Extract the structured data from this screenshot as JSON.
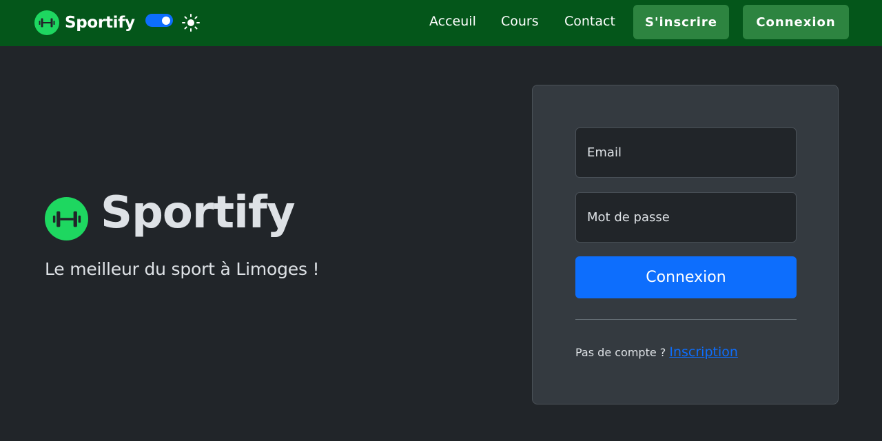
{
  "brand": {
    "name": "Sportify",
    "logo_icon": "dumbbell-icon",
    "logo_color": "#1ed760"
  },
  "theme": {
    "toggle_on": true,
    "toggle_icon": "sun-icon"
  },
  "nav": {
    "links": [
      "Acceuil",
      "Cours",
      "Contact"
    ],
    "signup_button": "S'inscrire",
    "login_button": "Connexion"
  },
  "hero": {
    "title": "Sportify",
    "subtitle": "Le meilleur du sport à Limoges !"
  },
  "login_form": {
    "email_placeholder": "Email",
    "password_placeholder": "Mot de passe",
    "submit_label": "Connexion",
    "no_account_text": "Pas de compte ?",
    "signup_link": "Inscription"
  },
  "colors": {
    "navbar": "#04561a",
    "nav_button": "#2d8440",
    "background": "#212529",
    "card": "#343a40",
    "primary": "#0d6efd"
  }
}
